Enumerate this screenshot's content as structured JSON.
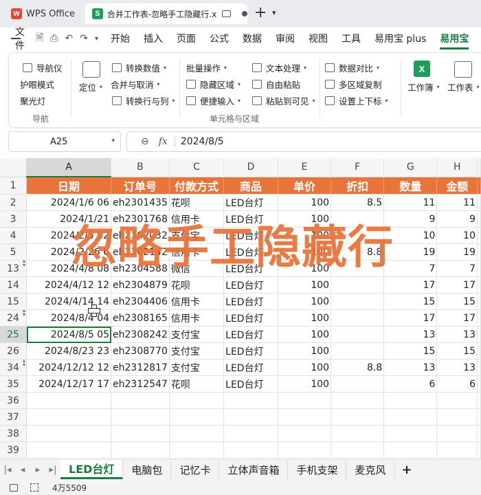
{
  "titlebar": {
    "wps_tab": "WPS Office",
    "doc_tab": "合并工作表-忽略手工隐藏行.x"
  },
  "menubar": {
    "file": "文件",
    "items": [
      "开始",
      "插入",
      "页面",
      "公式",
      "数据",
      "审阅",
      "视图",
      "工具",
      "易用宝 plus",
      "易用宝"
    ]
  },
  "ribbon": {
    "nav": {
      "navigator": "导航仪",
      "eye_mode": "护眼模式",
      "spotlight": "聚光灯",
      "label": "导航"
    },
    "locate": "定位",
    "convert_value": "转换数值",
    "merge_cancel": "合并与取消",
    "convert_row_col": "转换行与列",
    "batch_ops": "批量操作",
    "hide_area": "隐藏区域",
    "quick_input": "便捷输入",
    "text_proc": "文本处理",
    "free_paste": "自由粘贴",
    "paste_visible": "粘贴到可见",
    "data_compare": "数据对比",
    "multi_copy": "多区域复制",
    "super_sub": "设置上下标",
    "cell_area_label": "单元格与区域",
    "workbook": "工作簿",
    "worksheet": "工作表"
  },
  "formula_bar": {
    "name_box": "A25",
    "content": "2024/8/5"
  },
  "grid": {
    "columns": [
      "A",
      "B",
      "C",
      "D",
      "E",
      "F",
      "G",
      "H"
    ],
    "header_row": [
      "日期",
      "订单号",
      "付款方式",
      "商品",
      "单价",
      "折扣",
      "数量",
      "金额"
    ],
    "rows": [
      {
        "n": "2",
        "cells": [
          "2024/1/6 06",
          "eh2301435",
          "花呗",
          "LED台灯",
          "100",
          "8.5",
          "11",
          "11"
        ]
      },
      {
        "n": "3",
        "cells": [
          "2024/1/21",
          "eh2301768",
          "信用卡",
          "LED台灯",
          "100",
          "",
          "9",
          "9"
        ]
      },
      {
        "n": "4",
        "cells": [
          "2024/2/5 02",
          "eh2302032",
          "支付宝",
          "LED台灯",
          "100",
          "",
          "10",
          "10"
        ]
      },
      {
        "n": "5",
        "cells": [
          "2024/2/26 6",
          "eh2302142",
          "信用卡",
          "LED台灯",
          "100",
          "8.8",
          "19",
          "19"
        ]
      },
      {
        "n": "13",
        "cells": [
          "2024/4/8 08",
          "eh2304588",
          "微信",
          "LED台灯",
          "100",
          "",
          "7",
          "7"
        ]
      },
      {
        "n": "14",
        "cells": [
          "2024/4/12 12",
          "eh2304879",
          "花呗",
          "LED台灯",
          "100",
          "",
          "17",
          "17"
        ]
      },
      {
        "n": "15",
        "cells": [
          "2024/4/14 14",
          "eh2304406",
          "信用卡",
          "LED台灯",
          "100",
          "",
          "15",
          "15"
        ]
      },
      {
        "n": "24",
        "cells": [
          "2024/8/4 04",
          "eh2308165",
          "信用卡",
          "LED台灯",
          "100",
          "",
          "17",
          "17"
        ]
      },
      {
        "n": "25",
        "cells": [
          "2024/8/5 05",
          "eh2308242",
          "支付宝",
          "LED台灯",
          "100",
          "",
          "13",
          "13"
        ]
      },
      {
        "n": "26",
        "cells": [
          "2024/8/23 23",
          "eh2308770",
          "支付宝",
          "LED台灯",
          "100",
          "",
          "15",
          "15"
        ]
      },
      {
        "n": "34",
        "cells": [
          "2024/12/12 12",
          "eh2312817",
          "支付宝",
          "LED台灯",
          "100",
          "8.8",
          "13",
          "13"
        ]
      },
      {
        "n": "35",
        "cells": [
          "2024/12/17 17",
          "eh2312547",
          "花呗",
          "LED台灯",
          "100",
          "",
          "6",
          "6"
        ]
      },
      {
        "n": "36",
        "cells": [
          "",
          "",
          "",
          "",
          "",
          "",
          "",
          ""
        ]
      },
      {
        "n": "37",
        "cells": [
          "",
          "",
          "",
          "",
          "",
          "",
          "",
          ""
        ]
      },
      {
        "n": "38",
        "cells": [
          "",
          "",
          "",
          "",
          "",
          "",
          "",
          ""
        ]
      },
      {
        "n": "39",
        "cells": [
          "",
          "",
          "",
          "",
          "",
          "",
          "",
          ""
        ]
      }
    ]
  },
  "watermark": "忽略手工隐藏行",
  "sheet_tabs": [
    "LED台灯",
    "电脑包",
    "记忆卡",
    "立体声音箱",
    "手机支架",
    "麦克风"
  ],
  "status": {
    "text": "4万5509"
  }
}
